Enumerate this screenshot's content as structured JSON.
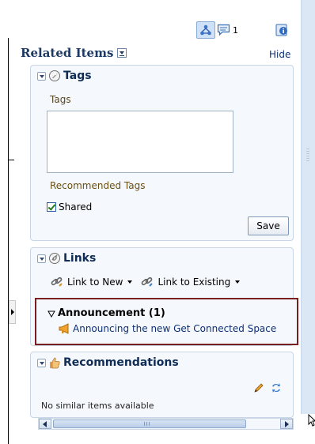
{
  "toolbar": {
    "people_icon": "people-network-icon",
    "comment_icon": "comment-bubble-icon",
    "comment_count": "1",
    "info_icon": "info-icon",
    "colors": {
      "accent": "#cfe1f6",
      "accent_border": "#86a9d5"
    }
  },
  "related": {
    "title": "Related Items",
    "hide_label": "Hide"
  },
  "tags": {
    "title": "Tags",
    "field_label": "Tags",
    "field_value": "",
    "recommended_label": "Recommended Tags",
    "shared_label": "Shared",
    "shared_checked": true,
    "save_label": "Save"
  },
  "links": {
    "title": "Links",
    "link_to_new": "Link to New",
    "link_to_existing": "Link to Existing",
    "group_title": "Announcement (1)",
    "group_item": "Announcing the new Get Connected Space"
  },
  "recommendations": {
    "title": "Recommendations",
    "empty_text": "No similar items available"
  },
  "colors": {
    "title_text": "#1c3a64",
    "link_text": "#0d2f77",
    "panel_bg": "#f5f9fd",
    "panel_border": "#c7d5e6",
    "highlight_border": "#7a1f1f",
    "tag_label": "#6b4f10"
  }
}
